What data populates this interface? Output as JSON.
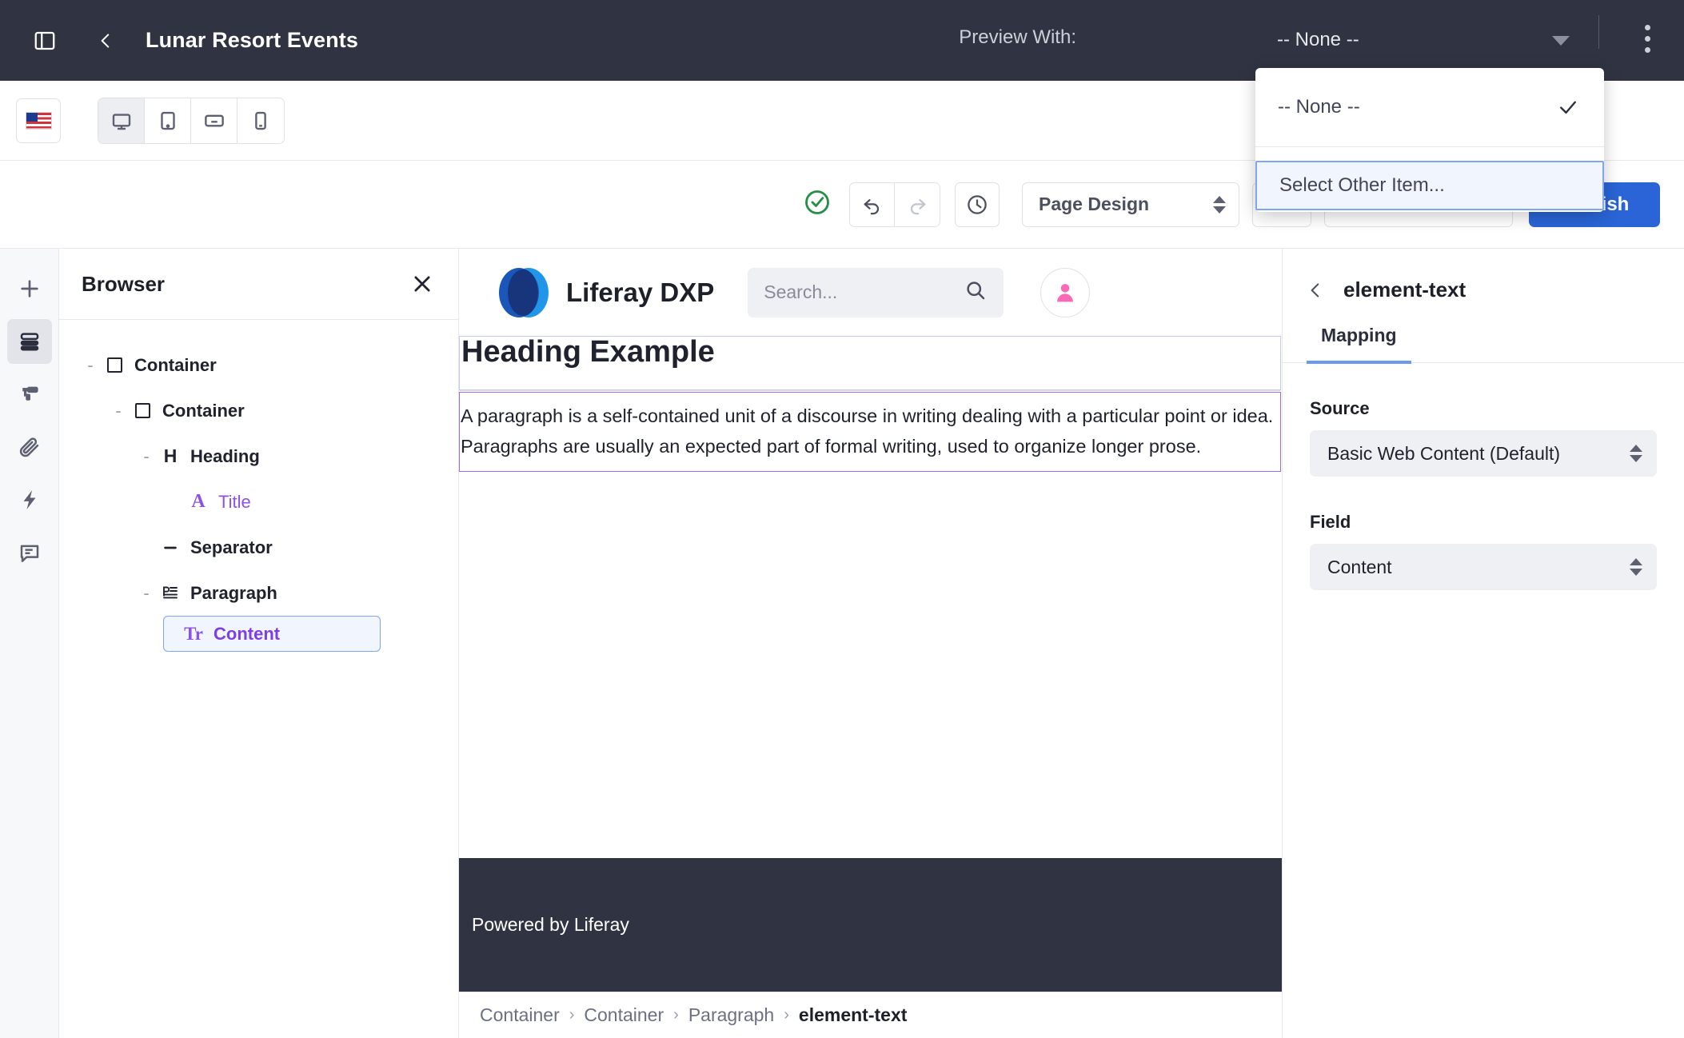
{
  "topbar": {
    "panel_toggle_icon": "sidebar-toggle-icon",
    "back_icon": "chevron-left-icon",
    "title": "Lunar Resort Events",
    "preview_label": "Preview With:",
    "preview_value": "-- None --",
    "kebab_icon": "vertical-dots-icon"
  },
  "preview_menu": {
    "items": [
      {
        "label": "-- None --",
        "checked": true
      },
      {
        "label": "Select Other Item...",
        "checked": false
      }
    ]
  },
  "devicebar": {
    "language_icon": "us-flag-icon",
    "devices": [
      {
        "name": "desktop",
        "icon": "desktop-icon",
        "active": true
      },
      {
        "name": "tablet",
        "icon": "tablet-icon",
        "active": false
      },
      {
        "name": "landscape-tablet",
        "icon": "landscape-tablet-icon",
        "active": false
      },
      {
        "name": "mobile",
        "icon": "mobile-icon",
        "active": false
      }
    ]
  },
  "actionbar": {
    "saved_icon": "check-circle-icon",
    "undo_icon": "undo-icon",
    "redo_icon": "redo-icon",
    "history_icon": "clock-icon",
    "page_design": "Page Design",
    "publish_label": "Publish"
  },
  "rail": {
    "items": [
      {
        "name": "add",
        "icon": "plus-icon",
        "active": false
      },
      {
        "name": "browser",
        "icon": "layers-icon",
        "active": true
      },
      {
        "name": "styles",
        "icon": "paint-roller-icon",
        "active": false
      },
      {
        "name": "fragments",
        "icon": "paperclip-icon",
        "active": false
      },
      {
        "name": "experience",
        "icon": "lightning-icon",
        "active": false
      },
      {
        "name": "comments",
        "icon": "comment-icon",
        "active": false
      }
    ]
  },
  "browser": {
    "title": "Browser",
    "close_icon": "close-icon",
    "tree": [
      {
        "label": "Container",
        "icon": "square-icon",
        "indent": 0,
        "toggle": "-",
        "state": "normal"
      },
      {
        "label": "Container",
        "icon": "square-icon",
        "indent": 1,
        "toggle": "-",
        "state": "normal"
      },
      {
        "label": "Heading",
        "icon": "heading-icon",
        "indent": 2,
        "toggle": "-",
        "state": "normal"
      },
      {
        "label": "Title",
        "icon": "text-a-icon",
        "indent": 3,
        "toggle": "",
        "state": "mapped"
      },
      {
        "label": "Separator",
        "icon": "separator-icon",
        "indent": 2,
        "toggle": "",
        "state": "normal"
      },
      {
        "label": "Paragraph",
        "icon": "paragraph-icon",
        "indent": 2,
        "toggle": "-",
        "state": "normal"
      },
      {
        "label": "Content",
        "icon": "text-tt-icon",
        "indent": 3,
        "toggle": "",
        "state": "selected"
      }
    ]
  },
  "canvas": {
    "brand": "Liferay DXP",
    "logo_icon": "liferay-logo-icon",
    "search_placeholder": "Search...",
    "search_icon": "search-icon",
    "avatar_icon": "user-avatar-icon",
    "heading": "Heading Example",
    "paragraph": "A paragraph is a self-contained unit of a discourse in writing dealing with a particular point or idea. Paragraphs are usually an expected part of formal writing, used to organize longer prose.",
    "footer": "Powered by Liferay",
    "breadcrumb": [
      "Container",
      "Container",
      "Paragraph",
      "element-text"
    ]
  },
  "right_panel": {
    "back_icon": "chevron-left-icon",
    "title": "element-text",
    "tabs": [
      {
        "label": "Mapping",
        "active": true
      }
    ],
    "source_label": "Source",
    "source_value": "Basic Web Content (Default)",
    "field_label": "Field",
    "field_value": "Content"
  },
  "colors": {
    "dark_bar": "#303342",
    "accent_blue": "#2a64d6",
    "mapped_purple": "#8b51e8",
    "selected_bg": "#f1f5fe",
    "selected_border": "#7fa7ee",
    "success_green": "#249046"
  }
}
